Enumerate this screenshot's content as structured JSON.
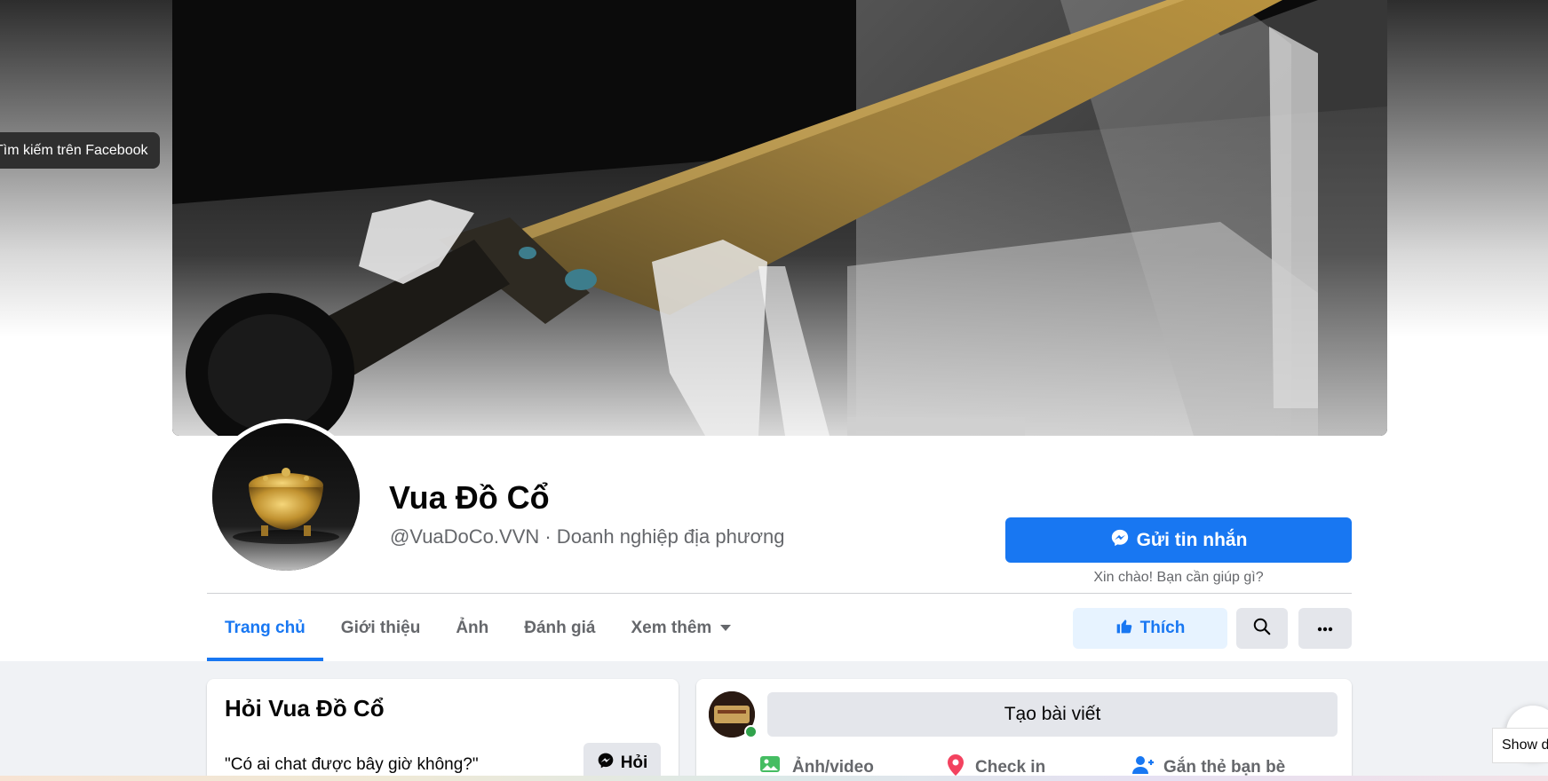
{
  "tooltip": {
    "text": "Tìm kiếm trên Facebook"
  },
  "page": {
    "name": "Vua Đồ Cổ",
    "subtitle": "@VuaDoCo.VVN · Doanh nghiệp địa phương"
  },
  "actions": {
    "message_label": "Gửi tin nhắn",
    "greeting": "Xin chào! Bạn cần giúp gì?",
    "like_label": "Thích"
  },
  "tabs": [
    {
      "label": "Trang chủ",
      "active": true
    },
    {
      "label": "Giới thiệu"
    },
    {
      "label": "Ảnh"
    },
    {
      "label": "Đánh giá"
    },
    {
      "label": "Xem thêm"
    }
  ],
  "ask": {
    "title": "Hỏi Vua Đồ Cổ",
    "question": "\"Có ai chat được bây giờ không?\"",
    "button_label": "Hỏi"
  },
  "composer": {
    "create_post_label": "Tạo bài viết",
    "actions": [
      {
        "label": "Ảnh/video",
        "icon": "photo-video-icon",
        "color": "#45bd62"
      },
      {
        "label": "Check in",
        "icon": "location-pin-icon",
        "color": "#f3425f"
      },
      {
        "label": "Gắn thẻ bạn bè",
        "icon": "tag-friends-icon",
        "color": "#1877f2"
      }
    ]
  },
  "overlay": {
    "show_desktop_label": "Show de"
  },
  "colors": {
    "accent": "#1877f2",
    "secondary_text": "#65676b",
    "button_gray": "#e4e6eb"
  }
}
